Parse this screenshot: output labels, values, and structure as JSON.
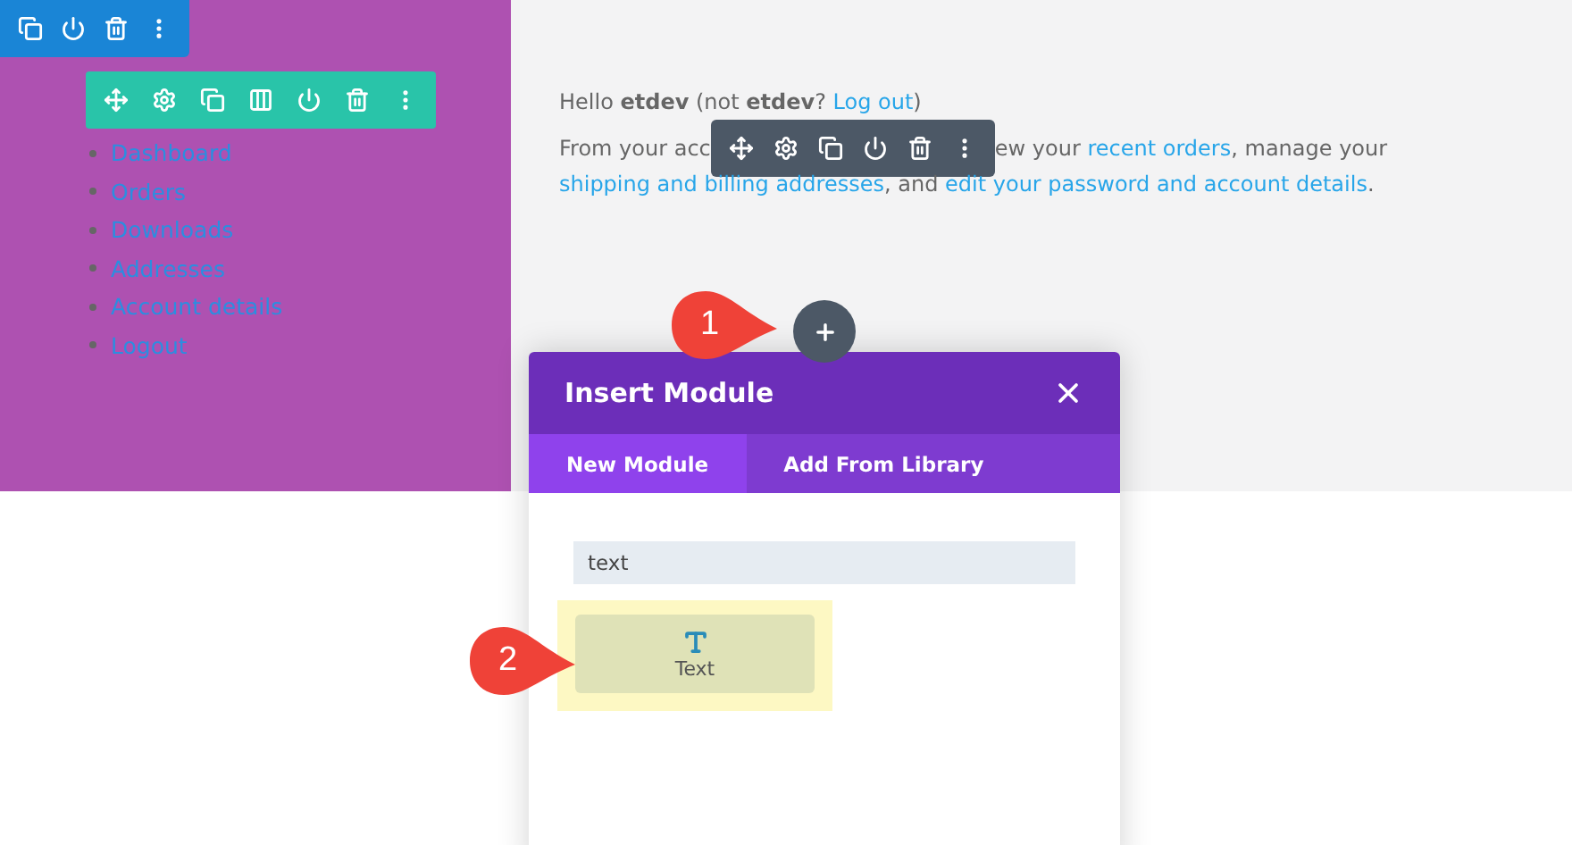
{
  "account_menu": [
    {
      "label": "Dashboard"
    },
    {
      "label": "Orders"
    },
    {
      "label": "Downloads"
    },
    {
      "label": "Addresses"
    },
    {
      "label": "Account details"
    },
    {
      "label": "Logout"
    }
  ],
  "greeting": {
    "before": "Hello **etdev** (not **etdev**? ",
    "link": "Log out",
    "after": ")"
  },
  "intro": [
    {
      "kind": "plain",
      "text": "From your acc"
    },
    {
      "kind": "toolbar"
    },
    {
      "kind": "plain",
      "text": "ew your "
    },
    {
      "kind": "link",
      "text": "recent orders"
    },
    {
      "kind": "plain",
      "text": ", manage your "
    },
    {
      "kind": "link",
      "text": "shipping and billing"
    },
    {
      "kind": "link",
      "text": "addresses"
    },
    {
      "kind": "plain",
      "text": ", and "
    },
    {
      "kind": "link",
      "text": "edit your password and account details"
    },
    {
      "kind": "plain",
      "text": "."
    }
  ],
  "modal": {
    "title": "Insert Module",
    "tabs": [
      {
        "label": "New Module",
        "selected": true
      },
      {
        "label": "Add From Library",
        "selected": false
      }
    ],
    "search": {
      "value": "text"
    },
    "results": [
      {
        "label": "Text",
        "highlighted": true
      }
    ]
  },
  "callouts": [
    "1",
    "2"
  ]
}
